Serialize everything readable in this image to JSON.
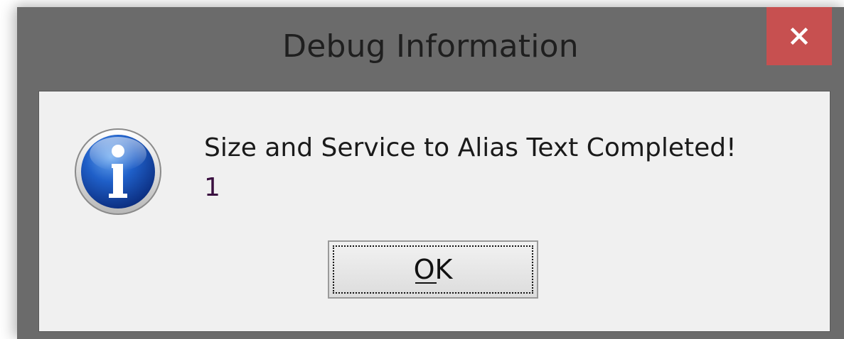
{
  "window": {
    "title": "Debug Information",
    "close_symbol": "×",
    "close_color": "#c75050",
    "frame_color": "#6b6b6b",
    "client_color": "#f0f0f0"
  },
  "dialog": {
    "icon": "information-icon",
    "message_line1": "Size and Service to Alias Text Completed!",
    "message_line2": "1"
  },
  "buttons": {
    "ok_label": "OK",
    "ok_mnemonic": "O"
  }
}
